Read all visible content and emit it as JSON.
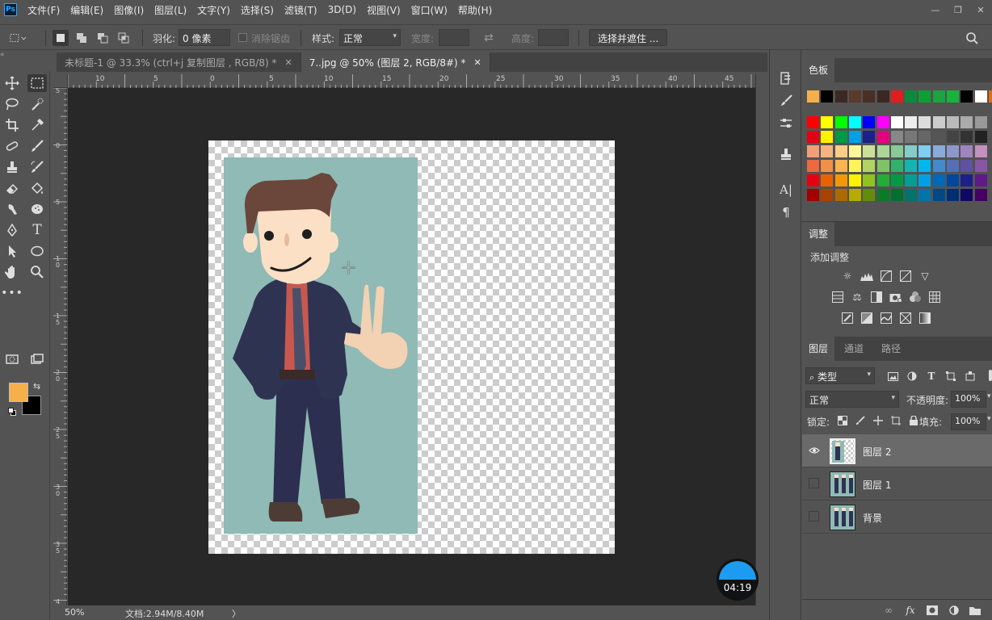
{
  "app": {
    "logo": "Ps"
  },
  "menu": [
    "文件(F)",
    "编辑(E)",
    "图像(I)",
    "图层(L)",
    "文字(Y)",
    "选择(S)",
    "滤镜(T)",
    "3D(D)",
    "视图(V)",
    "窗口(W)",
    "帮助(H)"
  ],
  "window_controls": [
    "minimize-icon",
    "restore-icon",
    "close-icon"
  ],
  "options": {
    "feather_label": "羽化:",
    "feather_value": "0 像素",
    "antialias_label": "消除锯齿",
    "style_label": "样式:",
    "style_value": "正常",
    "width_label": "宽度:",
    "height_label": "高度:",
    "select_mask_button": "选择并遮住 ..."
  },
  "tabs": [
    {
      "label": "未标题-1 @ 33.3% (ctrl+j 复制图层 , RGB/8) *",
      "active": false
    },
    {
      "label": "7..jpg @ 50% (图层 2, RGB/8#) *",
      "active": true
    }
  ],
  "rulers": {
    "top_labels": [
      "10",
      "5",
      "0",
      "5",
      "10",
      "15",
      "20",
      "25",
      "30",
      "35",
      "40",
      "45"
    ],
    "left_labels": [
      "5",
      "0",
      "5",
      "1\n0",
      "1\n5",
      "2\n0",
      "2\n5",
      "3\n0",
      "3\n5",
      "4"
    ]
  },
  "status": {
    "zoom": "50%",
    "doc_info": "文档:2.94M/8.40M",
    "arrow": "〉"
  },
  "timer": "04:19",
  "colors": {
    "foreground": "#f6b04b",
    "background": "#000000",
    "canvas_bg": "#8fbab5"
  },
  "swatches_panel": {
    "tab_label": "色板"
  },
  "adjustments_panel": {
    "tab_label": "调整",
    "add_label": "添加调整"
  },
  "layers_panel": {
    "tabs": [
      "图层",
      "通道",
      "路径"
    ],
    "filter_kind": "类型",
    "blend_mode": "正常",
    "opacity_label": "不透明度:",
    "opacity_value": "100%",
    "lock_label": "锁定:",
    "fill_label": "填充:",
    "fill_value": "100%",
    "layers": [
      {
        "name": "图层 2",
        "visible": true,
        "selected": true
      },
      {
        "name": "图层 1",
        "visible": false,
        "selected": false
      },
      {
        "name": "背景",
        "visible": false,
        "selected": false
      }
    ]
  }
}
